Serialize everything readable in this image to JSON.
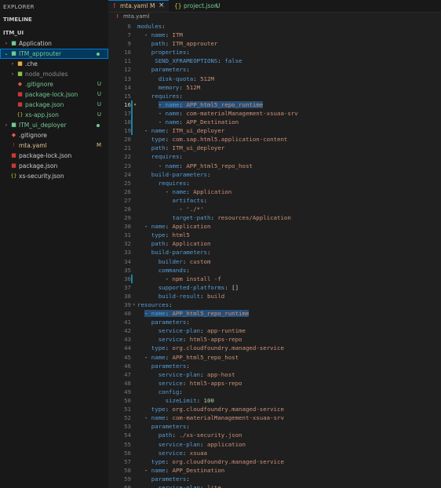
{
  "explorer": {
    "title": "EXPLORER",
    "timeline_label": "TIMELINE",
    "project_label": "ITM_UI",
    "items": [
      {
        "label": "Application",
        "icon": "folder-icon",
        "chevron": "›",
        "indent": 0,
        "icon_color": "#73c991",
        "label_color": "#cccccc",
        "badge": "",
        "dot": "",
        "selected": false
      },
      {
        "label": "ITM_approuter",
        "icon": "folder-open-icon",
        "chevron": "⌄",
        "indent": 0,
        "icon_color": "#73c991",
        "label_color": "#73c991",
        "badge": "",
        "dot": "#73c991",
        "selected": true
      },
      {
        "label": ".che",
        "icon": "folder-icon",
        "chevron": "›",
        "indent": 1,
        "icon_color": "#e8a94c",
        "label_color": "#cccccc",
        "badge": "",
        "dot": "",
        "selected": false
      },
      {
        "label": "node_modules",
        "icon": "folder-icon",
        "chevron": "›",
        "indent": 1,
        "icon_color": "#8bc34a",
        "label_color": "#8c8c8c",
        "badge": "",
        "dot": "",
        "selected": false
      },
      {
        "label": ".gitignore",
        "icon": "git-icon",
        "chevron": "",
        "indent": 1,
        "icon_color": "#e05d44",
        "label_color": "#73c991",
        "badge": "U",
        "dot": "",
        "selected": false
      },
      {
        "label": "package-lock.json",
        "icon": "npm-icon",
        "chevron": "",
        "indent": 1,
        "icon_color": "#cb3837",
        "label_color": "#73c991",
        "badge": "U",
        "dot": "",
        "selected": false
      },
      {
        "label": "package.json",
        "icon": "npm-icon",
        "chevron": "",
        "indent": 1,
        "icon_color": "#cb3837",
        "label_color": "#73c991",
        "badge": "U",
        "dot": "",
        "selected": false
      },
      {
        "label": "xs-app.json",
        "icon": "json-icon",
        "chevron": "",
        "indent": 1,
        "icon_color": "#cbcb41",
        "label_color": "#73c991",
        "badge": "U",
        "dot": "",
        "selected": false
      },
      {
        "label": "ITM_ui_deployer",
        "icon": "folder-icon",
        "chevron": "›",
        "indent": 0,
        "icon_color": "#73c991",
        "label_color": "#73c991",
        "badge": "",
        "dot": "#73c991",
        "selected": false
      },
      {
        "label": ".gitignore",
        "icon": "git-icon",
        "chevron": "",
        "indent": 0,
        "icon_color": "#e05d44",
        "label_color": "#cccccc",
        "badge": "",
        "dot": "",
        "selected": false
      },
      {
        "label": "mta.yaml",
        "icon": "yaml-icon",
        "chevron": "",
        "indent": 0,
        "icon_color": "#cb3837",
        "label_color": "#e2c08d",
        "badge": "M",
        "dot": "",
        "selected": false
      },
      {
        "label": "package-lock.json",
        "icon": "npm-icon",
        "chevron": "",
        "indent": 0,
        "icon_color": "#cb3837",
        "label_color": "#cccccc",
        "badge": "",
        "dot": "",
        "selected": false
      },
      {
        "label": "package.json",
        "icon": "npm-icon",
        "chevron": "",
        "indent": 0,
        "icon_color": "#cb3837",
        "label_color": "#cccccc",
        "badge": "",
        "dot": "",
        "selected": false
      },
      {
        "label": "xs-security.json",
        "icon": "json-icon",
        "chevron": "",
        "indent": 0,
        "icon_color": "#cbcb41",
        "label_color": "#cccccc",
        "badge": "",
        "dot": "",
        "selected": false
      }
    ]
  },
  "tabs": [
    {
      "icon": "yaml-icon",
      "icon_glyph": "!",
      "label": "mta.yaml",
      "badge": "M",
      "close": "×",
      "active": true
    },
    {
      "icon": "json-icon",
      "icon_glyph": "{}",
      "label": "project.json",
      "badge": "U",
      "close": "",
      "active": false
    }
  ],
  "breadcrumb": {
    "icon": "yaml-icon",
    "glyph": "!",
    "label": "mta.yaml"
  },
  "colors": {
    "accent": "#0078d4",
    "selection": "#04395e",
    "highlight": "#264f78",
    "key": "#569cd6",
    "string": "#ce9178",
    "number": "#b5cea8",
    "untracked": "#73c991",
    "modified": "#e2c08d"
  },
  "code": {
    "lines": [
      {
        "n": "6",
        "ind": 0,
        "t": [
          [
            "k",
            "modules"
          ],
          [
            "p",
            ":"
          ]
        ]
      },
      {
        "n": "7",
        "ind": 2,
        "t": [
          [
            "p",
            "- "
          ],
          [
            "k",
            "name"
          ],
          [
            "p",
            ": "
          ],
          [
            "v",
            "ITM"
          ]
        ]
      },
      {
        "n": "9",
        "ind": 4,
        "t": [
          [
            "k",
            "path"
          ],
          [
            "p",
            ": "
          ],
          [
            "v",
            "ITM_approuter"
          ]
        ]
      },
      {
        "n": "10",
        "ind": 4,
        "t": [
          [
            "k",
            "properties"
          ],
          [
            "p",
            ":"
          ]
        ]
      },
      {
        "n": "11",
        "ind": 5,
        "t": [
          [
            "k",
            "SEND_XFRAMEOPTIONS"
          ],
          [
            "p",
            ": "
          ],
          [
            "kw",
            "false"
          ]
        ]
      },
      {
        "n": "12",
        "ind": 4,
        "t": [
          [
            "k",
            "parameters"
          ],
          [
            "p",
            ":"
          ]
        ]
      },
      {
        "n": "13",
        "ind": 6,
        "t": [
          [
            "k",
            "disk-quota"
          ],
          [
            "p",
            ": "
          ],
          [
            "v",
            "512M"
          ]
        ]
      },
      {
        "n": "14",
        "ind": 6,
        "t": [
          [
            "k",
            "memory"
          ],
          [
            "p",
            ": "
          ],
          [
            "v",
            "512M"
          ]
        ]
      },
      {
        "n": "15",
        "ind": 4,
        "t": [
          [
            "k",
            "requires"
          ],
          [
            "p",
            ":"
          ]
        ]
      },
      {
        "n": "16",
        "ind": 6,
        "hl": true,
        "bulb": true,
        "cur": true,
        "mod": true,
        "t": [
          [
            "p",
            "- "
          ],
          [
            "k",
            "name"
          ],
          [
            "p",
            ": "
          ],
          [
            "v",
            "APP_html5_repo_runtime"
          ]
        ]
      },
      {
        "n": "17",
        "ind": 6,
        "mod": true,
        "t": [
          [
            "p",
            "- "
          ],
          [
            "k",
            "name"
          ],
          [
            "p",
            ": "
          ],
          [
            "v",
            "com-materialManagement-xsuaa-srv"
          ]
        ]
      },
      {
        "n": "18",
        "ind": 6,
        "mod": true,
        "t": [
          [
            "p",
            "- "
          ],
          [
            "k",
            "name"
          ],
          [
            "p",
            ": "
          ],
          [
            "v",
            "APP_Destination"
          ]
        ]
      },
      {
        "n": "19",
        "ind": 2,
        "mod": true,
        "t": [
          [
            "p",
            "- "
          ],
          [
            "k",
            "name"
          ],
          [
            "p",
            ": "
          ],
          [
            "v",
            "ITM_ui_deployer"
          ]
        ]
      },
      {
        "n": "20",
        "ind": 4,
        "t": [
          [
            "k",
            "type"
          ],
          [
            "p",
            ": "
          ],
          [
            "v",
            "com.sap.html5.application-content"
          ]
        ]
      },
      {
        "n": "21",
        "ind": 4,
        "t": [
          [
            "k",
            "path"
          ],
          [
            "p",
            ": "
          ],
          [
            "v",
            "ITM_ui_deployer"
          ]
        ]
      },
      {
        "n": "22",
        "ind": 4,
        "t": [
          [
            "k",
            "requires"
          ],
          [
            "p",
            ":"
          ]
        ]
      },
      {
        "n": "23",
        "ind": 6,
        "t": [
          [
            "p",
            "- "
          ],
          [
            "k",
            "name"
          ],
          [
            "p",
            ": "
          ],
          [
            "v",
            "APP_html5_repo_host"
          ]
        ]
      },
      {
        "n": "24",
        "ind": 4,
        "t": [
          [
            "k",
            "build-parameters"
          ],
          [
            "p",
            ":"
          ]
        ]
      },
      {
        "n": "25",
        "ind": 6,
        "t": [
          [
            "k",
            "requires"
          ],
          [
            "p",
            ":"
          ]
        ]
      },
      {
        "n": "26",
        "ind": 8,
        "t": [
          [
            "p",
            "- "
          ],
          [
            "k",
            "name"
          ],
          [
            "p",
            ": "
          ],
          [
            "v",
            "Application"
          ]
        ]
      },
      {
        "n": "27",
        "ind": 10,
        "t": [
          [
            "k",
            "artifacts"
          ],
          [
            "p",
            ":"
          ]
        ]
      },
      {
        "n": "28",
        "ind": 12,
        "t": [
          [
            "p",
            "- "
          ],
          [
            "v",
            "'./*'"
          ]
        ]
      },
      {
        "n": "29",
        "ind": 10,
        "t": [
          [
            "k",
            "target-path"
          ],
          [
            "p",
            ": "
          ],
          [
            "v",
            "resources/Application"
          ]
        ]
      },
      {
        "n": "30",
        "ind": 2,
        "t": [
          [
            "p",
            "- "
          ],
          [
            "k",
            "name"
          ],
          [
            "p",
            ": "
          ],
          [
            "v",
            "Application"
          ]
        ]
      },
      {
        "n": "31",
        "ind": 4,
        "t": [
          [
            "k",
            "type"
          ],
          [
            "p",
            ": "
          ],
          [
            "v",
            "html5"
          ]
        ]
      },
      {
        "n": "32",
        "ind": 4,
        "t": [
          [
            "k",
            "path"
          ],
          [
            "p",
            ": "
          ],
          [
            "v",
            "Application"
          ]
        ]
      },
      {
        "n": "33",
        "ind": 4,
        "t": [
          [
            "k",
            "build-parameters"
          ],
          [
            "p",
            ":"
          ]
        ]
      },
      {
        "n": "34",
        "ind": 6,
        "t": [
          [
            "k",
            "builder"
          ],
          [
            "p",
            ": "
          ],
          [
            "v",
            "custom"
          ]
        ]
      },
      {
        "n": "35",
        "ind": 6,
        "t": [
          [
            "k",
            "commands"
          ],
          [
            "p",
            ":"
          ]
        ]
      },
      {
        "n": "36",
        "ind": 8,
        "mod": true,
        "t": [
          [
            "p",
            "- "
          ],
          [
            "v",
            "npm install -f"
          ]
        ]
      },
      {
        "n": "37",
        "ind": 6,
        "t": [
          [
            "k",
            "supported-platforms"
          ],
          [
            "p",
            ": []"
          ]
        ]
      },
      {
        "n": "38",
        "ind": 6,
        "t": [
          [
            "k",
            "build-result"
          ],
          [
            "p",
            ": "
          ],
          [
            "v",
            "build"
          ]
        ]
      },
      {
        "n": "39",
        "ind": 0,
        "fold": true,
        "t": [
          [
            "k",
            "resources"
          ],
          [
            "p",
            ":"
          ]
        ]
      },
      {
        "n": "40",
        "ind": 2,
        "hl": true,
        "t": [
          [
            "p",
            "- "
          ],
          [
            "k",
            "name"
          ],
          [
            "p",
            ": "
          ],
          [
            "v",
            "APP_html5_repo_runtime"
          ]
        ]
      },
      {
        "n": "41",
        "ind": 4,
        "t": [
          [
            "k",
            "parameters"
          ],
          [
            "p",
            ":"
          ]
        ]
      },
      {
        "n": "42",
        "ind": 6,
        "t": [
          [
            "k",
            "service-plan"
          ],
          [
            "p",
            ": "
          ],
          [
            "v",
            "app-runtime"
          ]
        ]
      },
      {
        "n": "43",
        "ind": 6,
        "t": [
          [
            "k",
            "service"
          ],
          [
            "p",
            ": "
          ],
          [
            "v",
            "html5-apps-repo"
          ]
        ]
      },
      {
        "n": "44",
        "ind": 4,
        "t": [
          [
            "k",
            "type"
          ],
          [
            "p",
            ": "
          ],
          [
            "v",
            "org.cloudfoundry.managed-service"
          ]
        ]
      },
      {
        "n": "45",
        "ind": 2,
        "t": [
          [
            "p",
            "- "
          ],
          [
            "k",
            "name"
          ],
          [
            "p",
            ": "
          ],
          [
            "v",
            "APP_html5_repo_host"
          ]
        ]
      },
      {
        "n": "46",
        "ind": 4,
        "t": [
          [
            "k",
            "parameters"
          ],
          [
            "p",
            ":"
          ]
        ]
      },
      {
        "n": "47",
        "ind": 6,
        "t": [
          [
            "k",
            "service-plan"
          ],
          [
            "p",
            ": "
          ],
          [
            "v",
            "app-host"
          ]
        ]
      },
      {
        "n": "48",
        "ind": 6,
        "t": [
          [
            "k",
            "service"
          ],
          [
            "p",
            ": "
          ],
          [
            "v",
            "html5-apps-repo"
          ]
        ]
      },
      {
        "n": "49",
        "ind": 6,
        "t": [
          [
            "k",
            "config"
          ],
          [
            "p",
            ":"
          ]
        ]
      },
      {
        "n": "50",
        "ind": 8,
        "t": [
          [
            "k",
            "sizeLimit"
          ],
          [
            "p",
            ": "
          ],
          [
            "n",
            "100"
          ]
        ]
      },
      {
        "n": "51",
        "ind": 4,
        "t": [
          [
            "k",
            "type"
          ],
          [
            "p",
            ": "
          ],
          [
            "v",
            "org.cloudfoundry.managed-service"
          ]
        ]
      },
      {
        "n": "52",
        "ind": 2,
        "t": [
          [
            "p",
            "- "
          ],
          [
            "k",
            "name"
          ],
          [
            "p",
            ": "
          ],
          [
            "v",
            "com-materialManagement-xsuaa-srv"
          ]
        ]
      },
      {
        "n": "53",
        "ind": 4,
        "t": [
          [
            "k",
            "parameters"
          ],
          [
            "p",
            ":"
          ]
        ]
      },
      {
        "n": "54",
        "ind": 6,
        "t": [
          [
            "k",
            "path"
          ],
          [
            "p",
            ": "
          ],
          [
            "v",
            "./xs-security.json"
          ]
        ]
      },
      {
        "n": "55",
        "ind": 6,
        "t": [
          [
            "k",
            "service-plan"
          ],
          [
            "p",
            ": "
          ],
          [
            "v",
            "application"
          ]
        ]
      },
      {
        "n": "56",
        "ind": 6,
        "t": [
          [
            "k",
            "service"
          ],
          [
            "p",
            ": "
          ],
          [
            "v",
            "xsuaa"
          ]
        ]
      },
      {
        "n": "57",
        "ind": 4,
        "t": [
          [
            "k",
            "type"
          ],
          [
            "p",
            ": "
          ],
          [
            "v",
            "org.cloudfoundry.managed-service"
          ]
        ]
      },
      {
        "n": "58",
        "ind": 2,
        "t": [
          [
            "p",
            "- "
          ],
          [
            "k",
            "name"
          ],
          [
            "p",
            ": "
          ],
          [
            "v",
            "APP_Destination"
          ]
        ]
      },
      {
        "n": "59",
        "ind": 4,
        "t": [
          [
            "k",
            "parameters"
          ],
          [
            "p",
            ":"
          ]
        ]
      },
      {
        "n": "60",
        "ind": 6,
        "t": [
          [
            "k",
            "service-plan"
          ],
          [
            "p",
            ": "
          ],
          [
            "v",
            "lite"
          ]
        ]
      }
    ]
  }
}
